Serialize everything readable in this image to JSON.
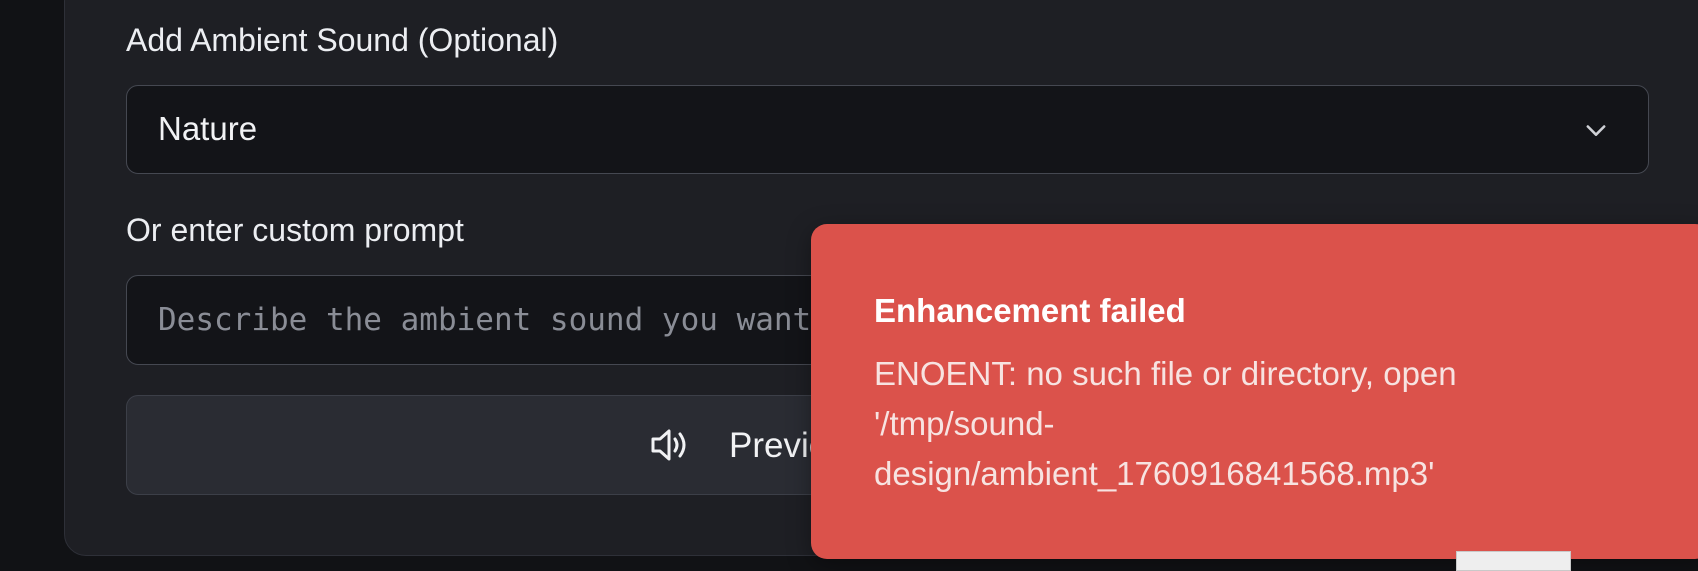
{
  "ambient": {
    "label": "Add Ambient Sound (Optional)",
    "selected": "Nature"
  },
  "custom": {
    "label": "Or enter custom prompt",
    "placeholder": "Describe the ambient sound you want..."
  },
  "preview": {
    "label": "Preview Ambient Sound",
    "icon": "speaker-icon"
  },
  "toast": {
    "title": "Enhancement failed",
    "message": "ENOENT: no such file or directory, open '/tmp/sound-design/ambient_1760916841568.mp3'",
    "color": "#db524b"
  },
  "colors": {
    "page_bg": "#111215",
    "panel_bg": "#1e1f24",
    "input_bg": "#131418",
    "button_bg": "#2a2c33"
  }
}
